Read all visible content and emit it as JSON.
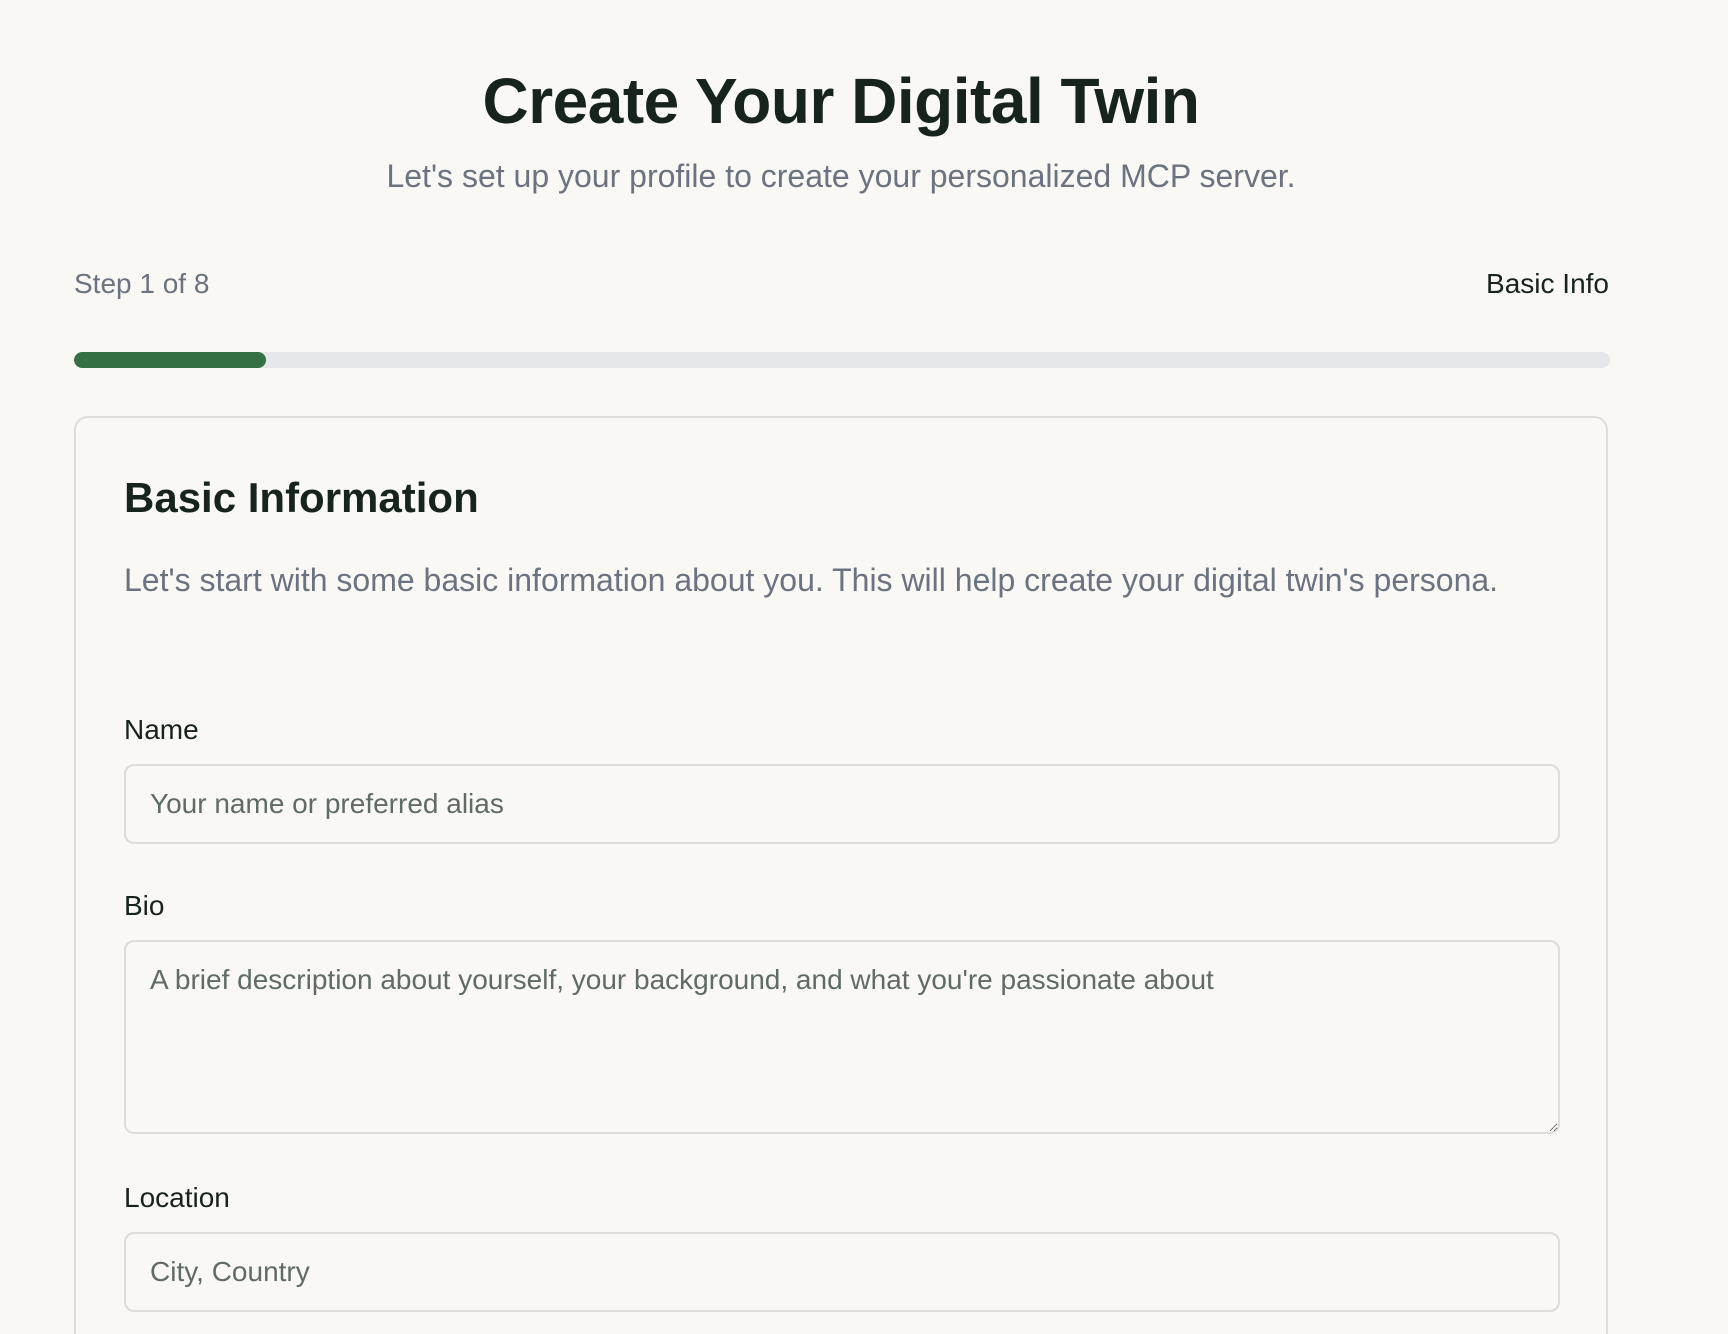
{
  "header": {
    "title": "Create Your Digital Twin",
    "subtitle": "Let's set up your profile to create your personalized MCP server."
  },
  "progress": {
    "step_text": "Step 1 of 8",
    "step_name": "Basic Info",
    "current_step": 1,
    "total_steps": 8,
    "fill_color": "#356f44"
  },
  "card": {
    "title": "Basic Information",
    "description": "Let's start with some basic information about you. This will help create your digital twin's persona.",
    "fields": {
      "name": {
        "label": "Name",
        "value": "",
        "placeholder": "Your name or preferred alias"
      },
      "bio": {
        "label": "Bio",
        "value": "",
        "placeholder": "A brief description about yourself, your background, and what you're passionate about"
      },
      "location": {
        "label": "Location",
        "value": "",
        "placeholder": "City, Country"
      }
    }
  }
}
